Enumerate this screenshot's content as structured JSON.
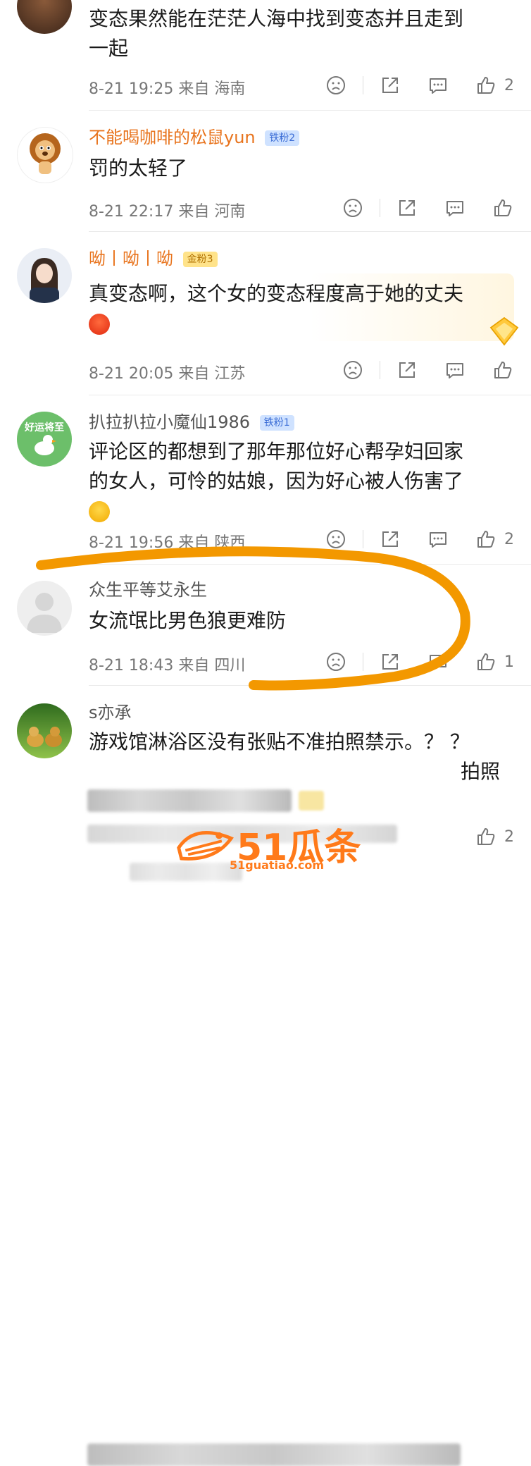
{
  "comments": [
    {
      "text_lines": [
        "变态果然能在茫茫人海中找到变态并且走到",
        "一起"
      ],
      "time": "8-21 19:25",
      "location": "来自 海南",
      "likes": "2"
    },
    {
      "name": "不能喝咖啡的松鼠yun",
      "badge": "铁粉2",
      "text": "罚的太轻了",
      "time": "8-21 22:17",
      "location": "来自 河南",
      "likes": ""
    },
    {
      "name": "呦丨呦丨呦",
      "badge": "金粉3",
      "text": "真变态啊，这个女的变态程度高于她的丈夫",
      "time": "8-21 20:05",
      "location": "来自 江苏",
      "likes": ""
    },
    {
      "name": "扒拉扒拉小魔仙1986",
      "badge": "铁粉1",
      "avatar_text": "好运将至",
      "text_lines": [
        "评论区的都想到了那年那位好心帮孕妇回家",
        "的女人，可怜的姑娘，因为好心被人伤害了"
      ],
      "time": "8-21 19:56",
      "location": "来自 陕西",
      "likes": "2"
    },
    {
      "name": "众生平等艾永生",
      "text": "女流氓比男色狼更难防",
      "time": "8-21 18:43",
      "location": "来自 四川",
      "likes": "1"
    },
    {
      "name": "s亦承",
      "text": "游戏馆淋浴区没有张贴不准拍照禁示。？ ？",
      "text_tail": "拍照",
      "likes": "2"
    }
  ],
  "watermark": {
    "main": "51瓜条",
    "sub": "51guatiao.com"
  },
  "colors": {
    "accent_orange": "#f39800",
    "name_orange": "#e8731c",
    "watermark": "#ff7a1a"
  }
}
